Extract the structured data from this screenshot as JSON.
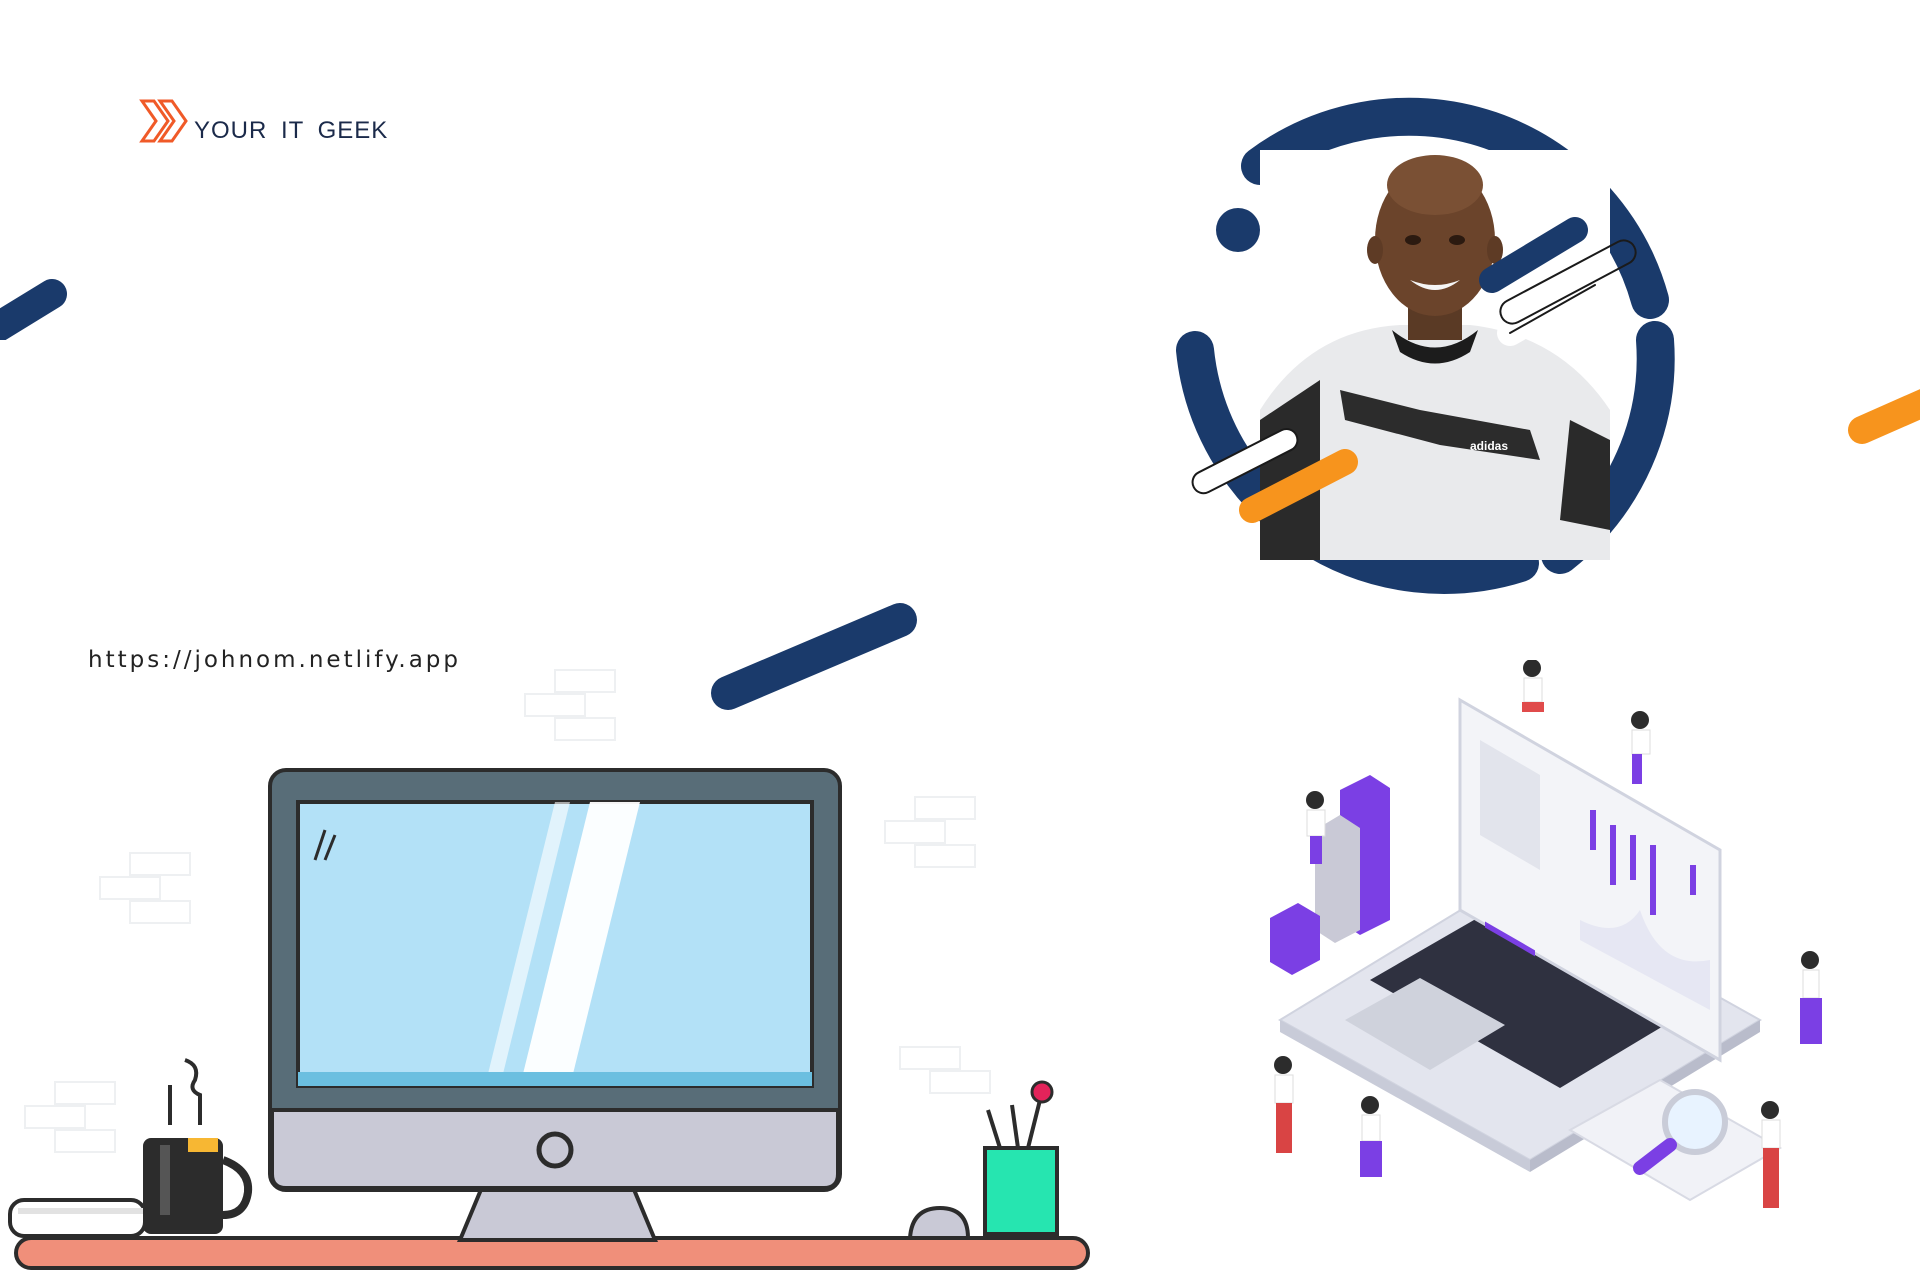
{
  "brand": {
    "name": "YOUR IT GEEK",
    "logo_icon": "chevron-x-logo"
  },
  "website": {
    "url": "https://johnom.netlify.app"
  },
  "portrait": {
    "shirt_brand": "adidas"
  },
  "colors": {
    "navy": "#1a3a6b",
    "orange": "#f7941d",
    "purple": "#7b3fe4",
    "brand_orange": "#f05a28"
  }
}
